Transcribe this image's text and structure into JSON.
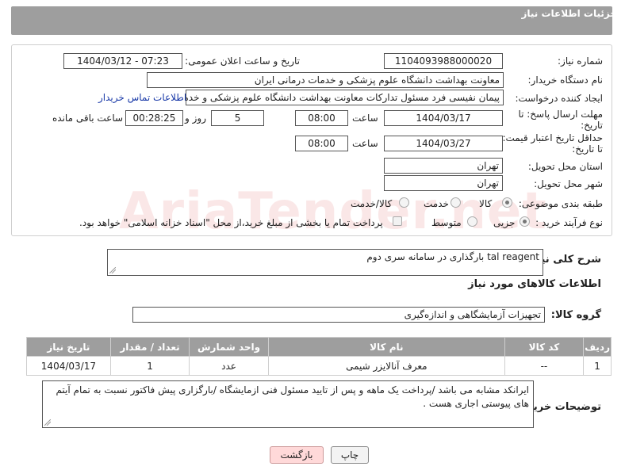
{
  "header": {
    "title": "جزئیات اطلاعات نیاز"
  },
  "watermark": "AriaTender.net",
  "form": {
    "need_number_label": "شماره نیاز:",
    "need_number": "1104093988000020",
    "announce_label": "تاریخ و ساعت اعلان عمومی:",
    "announce_value": "1404/03/12 - 07:23",
    "buyer_org_label": "نام دستگاه خریدار:",
    "buyer_org": "معاونت بهداشت دانشگاه علوم پزشکی و خدمات درمانی ایران",
    "requester_label": "ایجاد کننده درخواست:",
    "requester": "پیمان نفیسی فرد مسئول تدارکات  معاونت بهداشت دانشگاه علوم پزشکی و خدمات درمانی ایران",
    "contact_link": "اطلاعات تماس خریدار",
    "deadline_label_1": "مهلت ارسال پاسخ: تا",
    "deadline_label_2": "تاریخ:",
    "deadline_date": "1404/03/17",
    "time_label": "ساعت",
    "deadline_time": "08:00",
    "days_value": "5",
    "days_label": "روز و",
    "remaining_time": "00:28:25",
    "remaining_label": "ساعت باقی مانده",
    "price_validity_label_1": "حداقل تاریخ اعتبار قیمت:",
    "price_validity_label_2": "تا تاریخ:",
    "price_date": "1404/03/27",
    "price_time": "08:00",
    "province_label": "استان محل تحویل:",
    "province": "تهران",
    "city_label": "شهر محل تحویل:",
    "city": "تهران",
    "category_label": "طبقه بندی موضوعی:",
    "category_options": [
      "کالا",
      "خدمت",
      "کالا/خدمت"
    ],
    "category_selected": "کالا",
    "process_label": "نوع فرآیند خرید :",
    "process_options": [
      "جزیی",
      "متوسط"
    ],
    "process_selected": "جزیی",
    "payment_note": "پرداخت تمام یا بخشی از مبلغ خرید،از محل \"اسناد خزانه اسلامی\" خواهد بود."
  },
  "description": {
    "label": "شرح کلی نیاز:",
    "value": "tal reagent بارگذاری در سامانه سری دوم"
  },
  "goods_section_title": "اطلاعات کالاهای مورد نیاز",
  "goods_group": {
    "label": "گروه کالا:",
    "value": "تجهیزات آزمایشگاهی و اندازه‌گیری"
  },
  "table": {
    "headers": [
      "ردیف",
      "کد کالا",
      "نام کالا",
      "واحد شمارش",
      "تعداد / مقدار",
      "تاریخ نیاز"
    ],
    "rows": [
      [
        "1",
        "--",
        "معرف آنالایزر شیمی",
        "عدد",
        "1",
        "1404/03/17"
      ]
    ]
  },
  "buyer_notes": {
    "label": "توضیحات خریدار:",
    "value": "ایرانکد مشابه می باشد /پرداخت یک ماهه و پس از تایید مسئول فنی ازمایشگاه /بارگزاری پیش فاکتور نسبت به تمام آیتم های پیوستی اجاری هست ."
  },
  "buttons": {
    "print": "چاپ",
    "back": "بازگشت"
  }
}
